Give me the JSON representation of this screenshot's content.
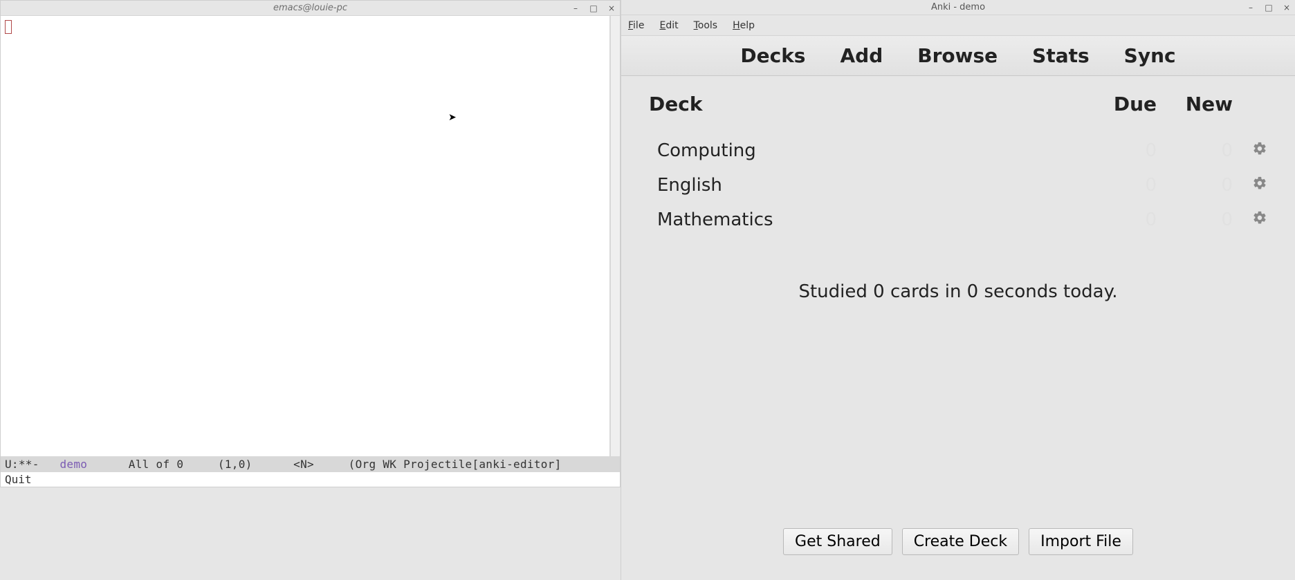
{
  "emacs": {
    "title": "emacs@louie-pc",
    "modeline": {
      "prefix": "U:**-   ",
      "buffer_name": "demo",
      "mid": "      All of 0     (1,0)      <N>     (Org WK Projectile[anki-editor]"
    },
    "minibuffer": "Quit"
  },
  "anki": {
    "title": "Anki - demo",
    "menubar": {
      "file": "File",
      "edit": "Edit",
      "tools": "Tools",
      "help": "Help"
    },
    "toolbar": {
      "decks": "Decks",
      "add": "Add",
      "browse": "Browse",
      "stats": "Stats",
      "sync": "Sync"
    },
    "headers": {
      "deck": "Deck",
      "due": "Due",
      "new": "New"
    },
    "decks": [
      {
        "name": "Computing",
        "due": "0",
        "new": "0"
      },
      {
        "name": "English",
        "due": "0",
        "new": "0"
      },
      {
        "name": "Mathematics",
        "due": "0",
        "new": "0"
      }
    ],
    "status": "Studied 0 cards in 0 seconds today.",
    "footer": {
      "get_shared": "Get Shared",
      "create_deck": "Create Deck",
      "import_file": "Import File"
    }
  },
  "window_controls": {
    "min": "–",
    "max": "□",
    "close": "×"
  }
}
